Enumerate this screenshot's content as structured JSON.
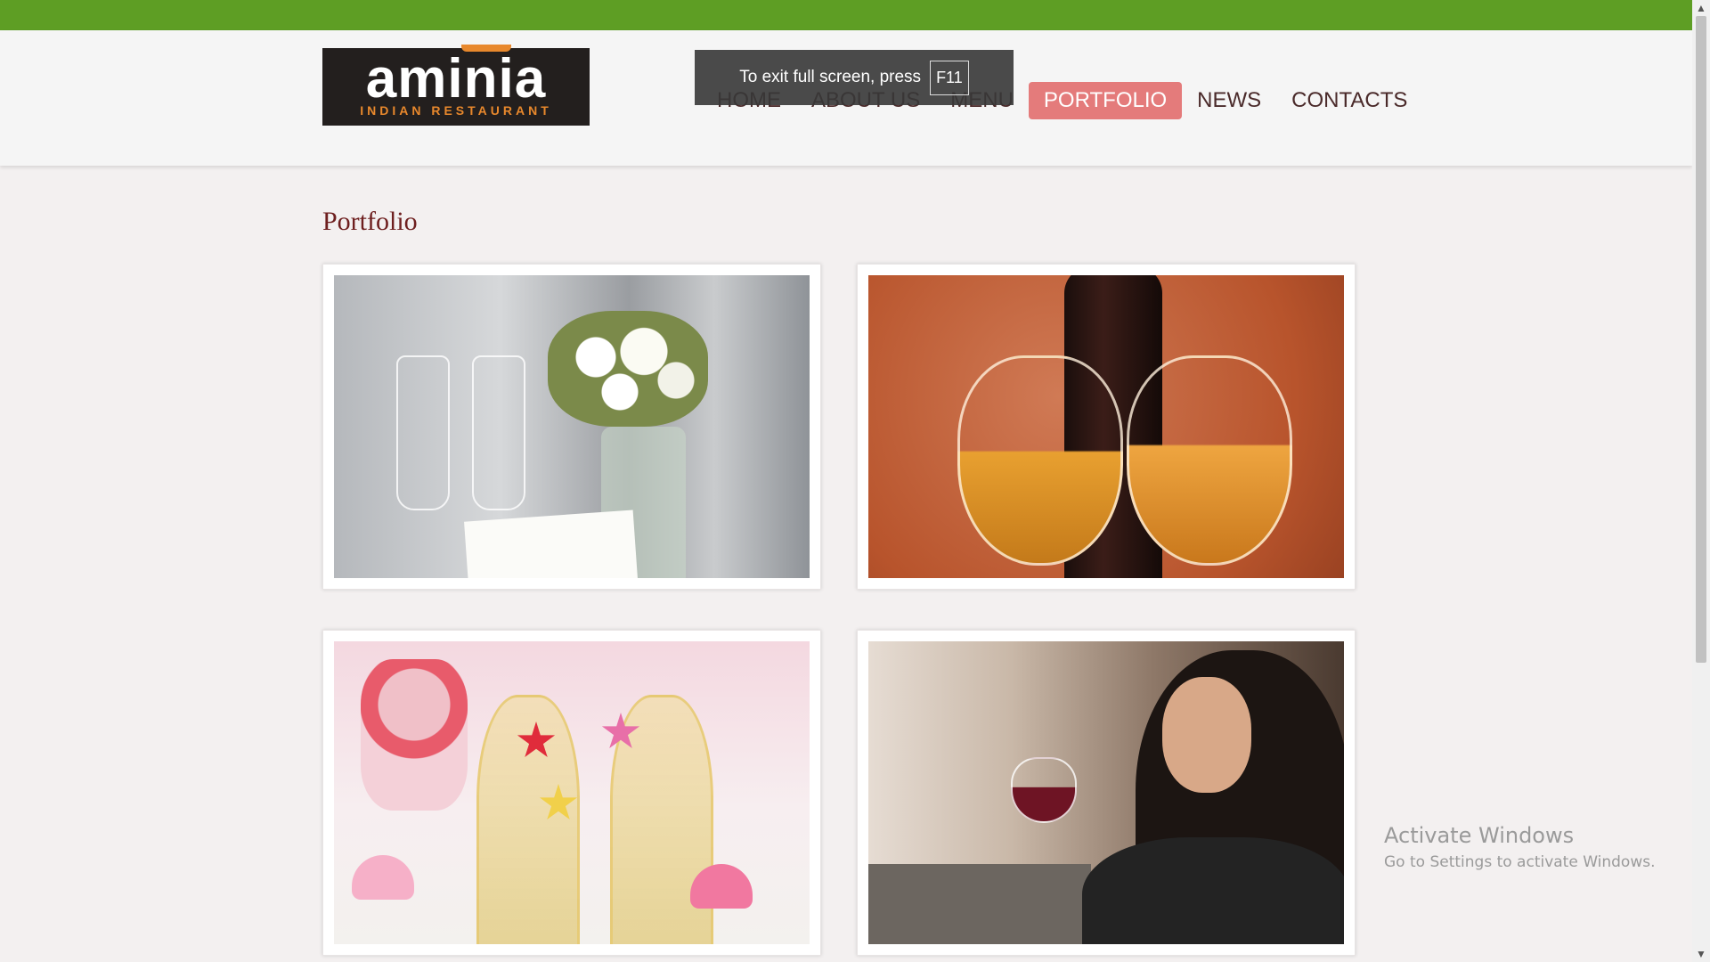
{
  "logo": {
    "name": "aminia",
    "subtitle": "INDIAN RESTAURANT"
  },
  "nav": [
    {
      "label": "HOME"
    },
    {
      "label": "ABOUT US"
    },
    {
      "label": "MENU"
    },
    {
      "label": "PORTFOLIO",
      "active": true
    },
    {
      "label": "NEWS"
    },
    {
      "label": "CONTACTS"
    }
  ],
  "fullscreen_toast": {
    "text": "To exit full screen, press",
    "key": "F11"
  },
  "page": {
    "title": "Portfolio"
  },
  "windows_watermark": {
    "title": "Activate Windows",
    "subtitle": "Go to Settings to activate Windows."
  },
  "colors": {
    "topbar": "#5e9e24",
    "nav_active": "#e47b7b",
    "title": "#6e1f1f"
  }
}
